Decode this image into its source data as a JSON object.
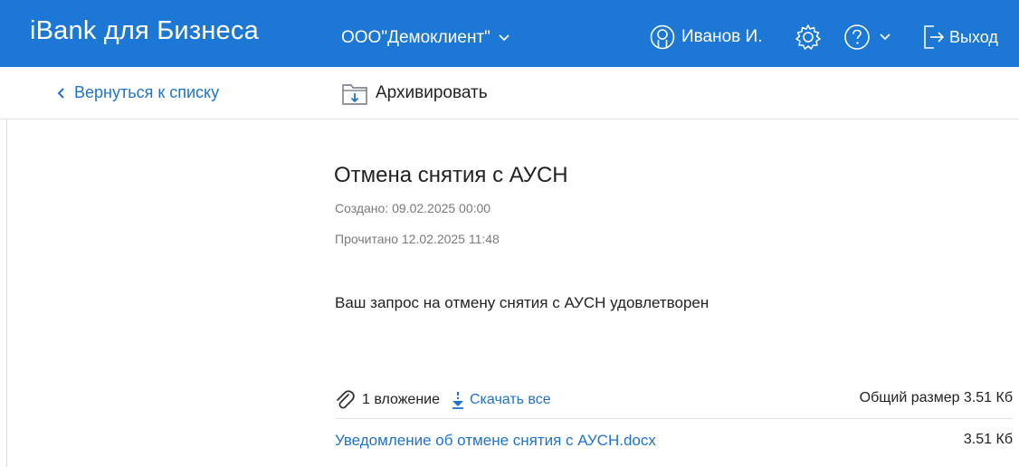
{
  "header": {
    "brand": "iBank для Бизнеса",
    "organization": "ООО\"Демоклиент\"",
    "user_name": "Иванов И.",
    "logout_label": "Выход",
    "background_color": "#1c78d4"
  },
  "toolbar": {
    "back_label": "Вернуться к списку",
    "archive_label": "Архивировать"
  },
  "message": {
    "title": "Отмена снятия с АУСН",
    "created": "Создано: 09.02.2025 00:00",
    "read": "Прочитано 12.02.2025 11:48",
    "body": "Ваш запрос на отмену снятия с АУСН удовлетворен"
  },
  "attachments": {
    "count_label": "1 вложение",
    "download_all_label": "Скачать все",
    "total_size_label": "Общий размер 3.51 Кб",
    "files": [
      {
        "name": "Уведомление об отмене снятия с АУСН.docx",
        "size": "3.51 Кб"
      }
    ]
  },
  "icons": [
    "user-icon",
    "gear-icon",
    "help-icon",
    "chevron-down-icon",
    "logout-icon",
    "chevron-left-icon",
    "archive-folder-icon",
    "paperclip-icon",
    "download-icon"
  ]
}
